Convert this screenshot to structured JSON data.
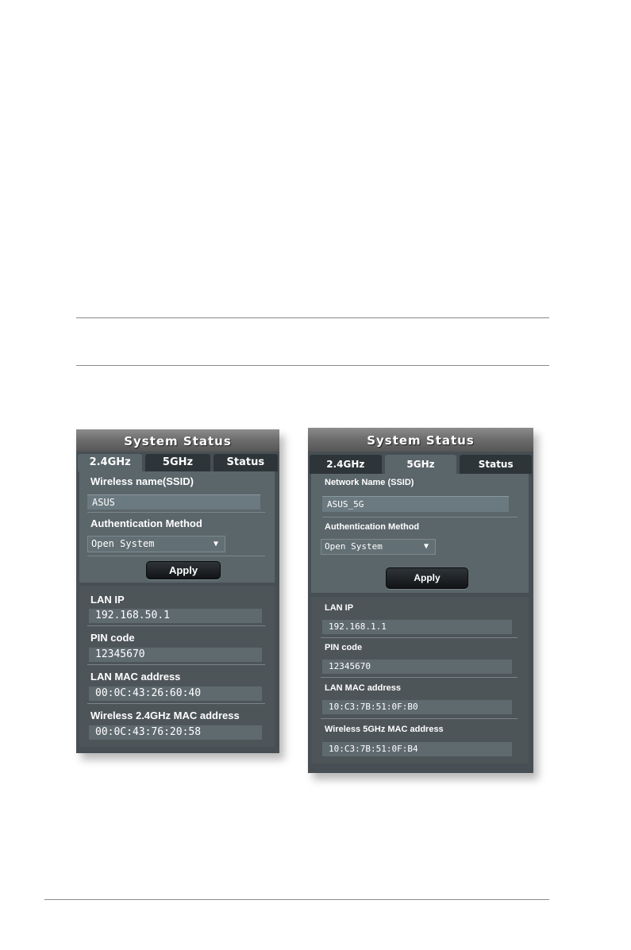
{
  "left_panel": {
    "title": "System Status",
    "tabs": [
      {
        "label": "2.4GHz",
        "active": true
      },
      {
        "label": "5GHz",
        "active": false
      },
      {
        "label": "Status",
        "active": false
      }
    ],
    "ssid_label": "Wireless name(SSID)",
    "ssid_value": "ASUS",
    "auth_label": "Authentication Method",
    "auth_value": "Open System",
    "apply_label": "Apply",
    "info": [
      {
        "label": "LAN IP",
        "value": "192.168.50.1"
      },
      {
        "label": "PIN code",
        "value": "12345670"
      },
      {
        "label": "LAN MAC address",
        "value": "00:0C:43:26:60:40"
      },
      {
        "label": "Wireless 2.4GHz MAC address",
        "value": "00:0C:43:76:20:58"
      }
    ]
  },
  "right_panel": {
    "title": "System Status",
    "tabs": [
      {
        "label": "2.4GHz",
        "active": false
      },
      {
        "label": "5GHz",
        "active": true
      },
      {
        "label": "Status",
        "active": false
      }
    ],
    "ssid_label": "Network Name (SSID)",
    "ssid_value": "ASUS_5G",
    "auth_label": "Authentication Method",
    "auth_value": "Open System",
    "apply_label": "Apply",
    "info": [
      {
        "label": "LAN IP",
        "value": "192.168.1.1"
      },
      {
        "label": "PIN code",
        "value": "12345670"
      },
      {
        "label": "LAN MAC address",
        "value": "10:C3:7B:51:0F:B0"
      },
      {
        "label": "Wireless 5GHz MAC address",
        "value": "10:C3:7B:51:0F:B4"
      }
    ]
  },
  "icons": {
    "dropdown_arrow": "triangle-down-icon"
  }
}
